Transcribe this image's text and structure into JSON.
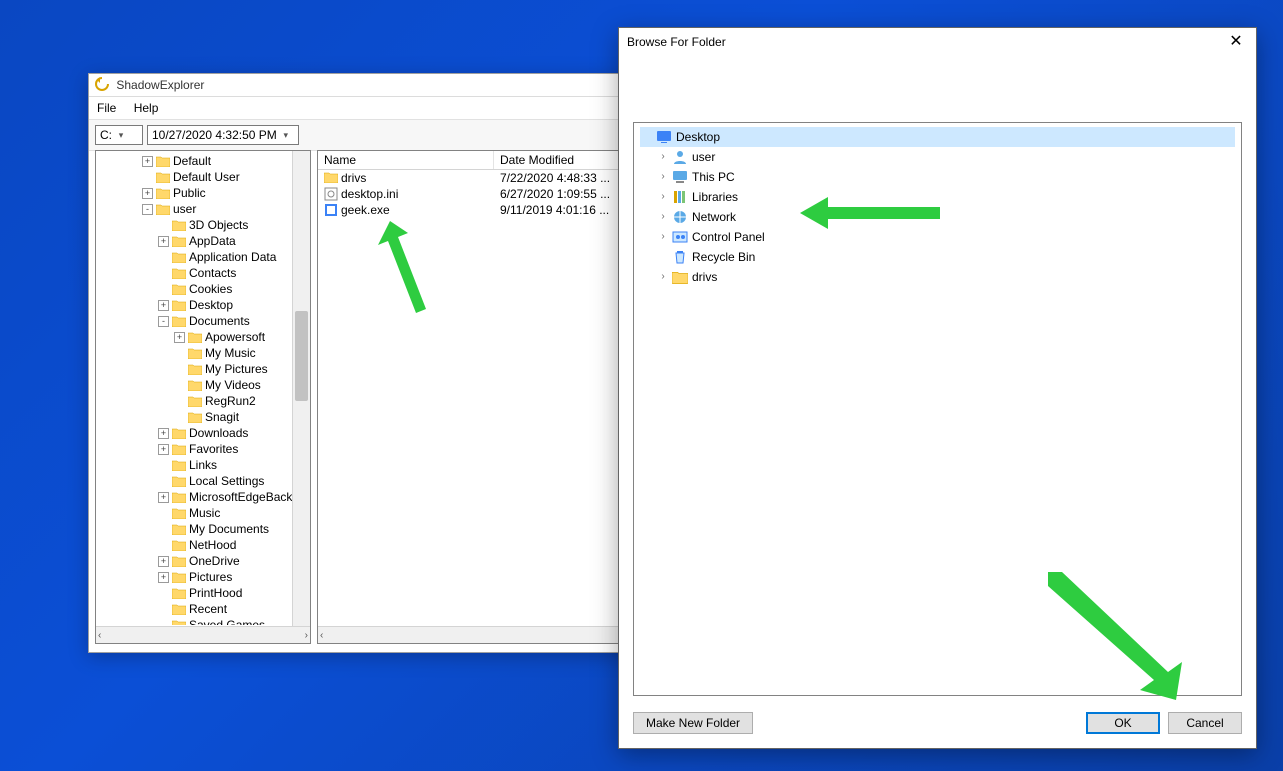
{
  "shadowExplorer": {
    "title": "ShadowExplorer",
    "menu": {
      "file": "File",
      "help": "Help"
    },
    "drive": "C:",
    "snapshot": "10/27/2020 4:32:50 PM",
    "treeNodes": [
      {
        "pad": 44,
        "pm": "+",
        "label": "Default"
      },
      {
        "pad": 44,
        "pm": "",
        "label": "Default User"
      },
      {
        "pad": 44,
        "pm": "+",
        "label": "Public"
      },
      {
        "pad": 44,
        "pm": "-",
        "label": "user"
      },
      {
        "pad": 60,
        "pm": "",
        "label": "3D Objects"
      },
      {
        "pad": 60,
        "pm": "+",
        "label": "AppData"
      },
      {
        "pad": 60,
        "pm": "",
        "label": "Application Data"
      },
      {
        "pad": 60,
        "pm": "",
        "label": "Contacts"
      },
      {
        "pad": 60,
        "pm": "",
        "label": "Cookies"
      },
      {
        "pad": 60,
        "pm": "+",
        "label": "Desktop"
      },
      {
        "pad": 60,
        "pm": "-",
        "label": "Documents"
      },
      {
        "pad": 76,
        "pm": "+",
        "label": "Apowersoft"
      },
      {
        "pad": 76,
        "pm": "",
        "label": "My Music"
      },
      {
        "pad": 76,
        "pm": "",
        "label": "My Pictures"
      },
      {
        "pad": 76,
        "pm": "",
        "label": "My Videos"
      },
      {
        "pad": 76,
        "pm": "",
        "label": "RegRun2"
      },
      {
        "pad": 76,
        "pm": "",
        "label": "Snagit"
      },
      {
        "pad": 60,
        "pm": "+",
        "label": "Downloads"
      },
      {
        "pad": 60,
        "pm": "+",
        "label": "Favorites"
      },
      {
        "pad": 60,
        "pm": "",
        "label": "Links"
      },
      {
        "pad": 60,
        "pm": "",
        "label": "Local Settings"
      },
      {
        "pad": 60,
        "pm": "+",
        "label": "MicrosoftEdgeBacku"
      },
      {
        "pad": 60,
        "pm": "",
        "label": "Music"
      },
      {
        "pad": 60,
        "pm": "",
        "label": "My Documents"
      },
      {
        "pad": 60,
        "pm": "",
        "label": "NetHood"
      },
      {
        "pad": 60,
        "pm": "+",
        "label": "OneDrive"
      },
      {
        "pad": 60,
        "pm": "+",
        "label": "Pictures"
      },
      {
        "pad": 60,
        "pm": "",
        "label": "PrintHood"
      },
      {
        "pad": 60,
        "pm": "",
        "label": "Recent"
      },
      {
        "pad": 60,
        "pm": "",
        "label": "Saved Games"
      }
    ],
    "columns": {
      "name": "Name",
      "date": "Date Modified"
    },
    "rows": [
      {
        "icon": "folder",
        "name": "drivs",
        "date": "7/22/2020 4:48:33 ..."
      },
      {
        "icon": "ini",
        "name": "desktop.ini",
        "date": "6/27/2020 1:09:55 ..."
      },
      {
        "icon": "exe",
        "name": "geek.exe",
        "date": "9/11/2019 4:01:16 ..."
      }
    ]
  },
  "browseDialog": {
    "title": "Browse For Folder",
    "tree": [
      {
        "pad": 2,
        "chev": "",
        "icon": "desktop",
        "label": "Desktop",
        "selected": true
      },
      {
        "pad": 18,
        "chev": ">",
        "icon": "user",
        "label": "user"
      },
      {
        "pad": 18,
        "chev": ">",
        "icon": "pc",
        "label": "This PC"
      },
      {
        "pad": 18,
        "chev": ">",
        "icon": "lib",
        "label": "Libraries"
      },
      {
        "pad": 18,
        "chev": ">",
        "icon": "net",
        "label": "Network"
      },
      {
        "pad": 18,
        "chev": ">",
        "icon": "cpl",
        "label": "Control Panel"
      },
      {
        "pad": 18,
        "chev": "",
        "icon": "recycle",
        "label": "Recycle Bin"
      },
      {
        "pad": 18,
        "chev": ">",
        "icon": "folder",
        "label": "drivs"
      }
    ],
    "buttons": {
      "makeNewFolder": "Make New Folder",
      "ok": "OK",
      "cancel": "Cancel"
    }
  }
}
